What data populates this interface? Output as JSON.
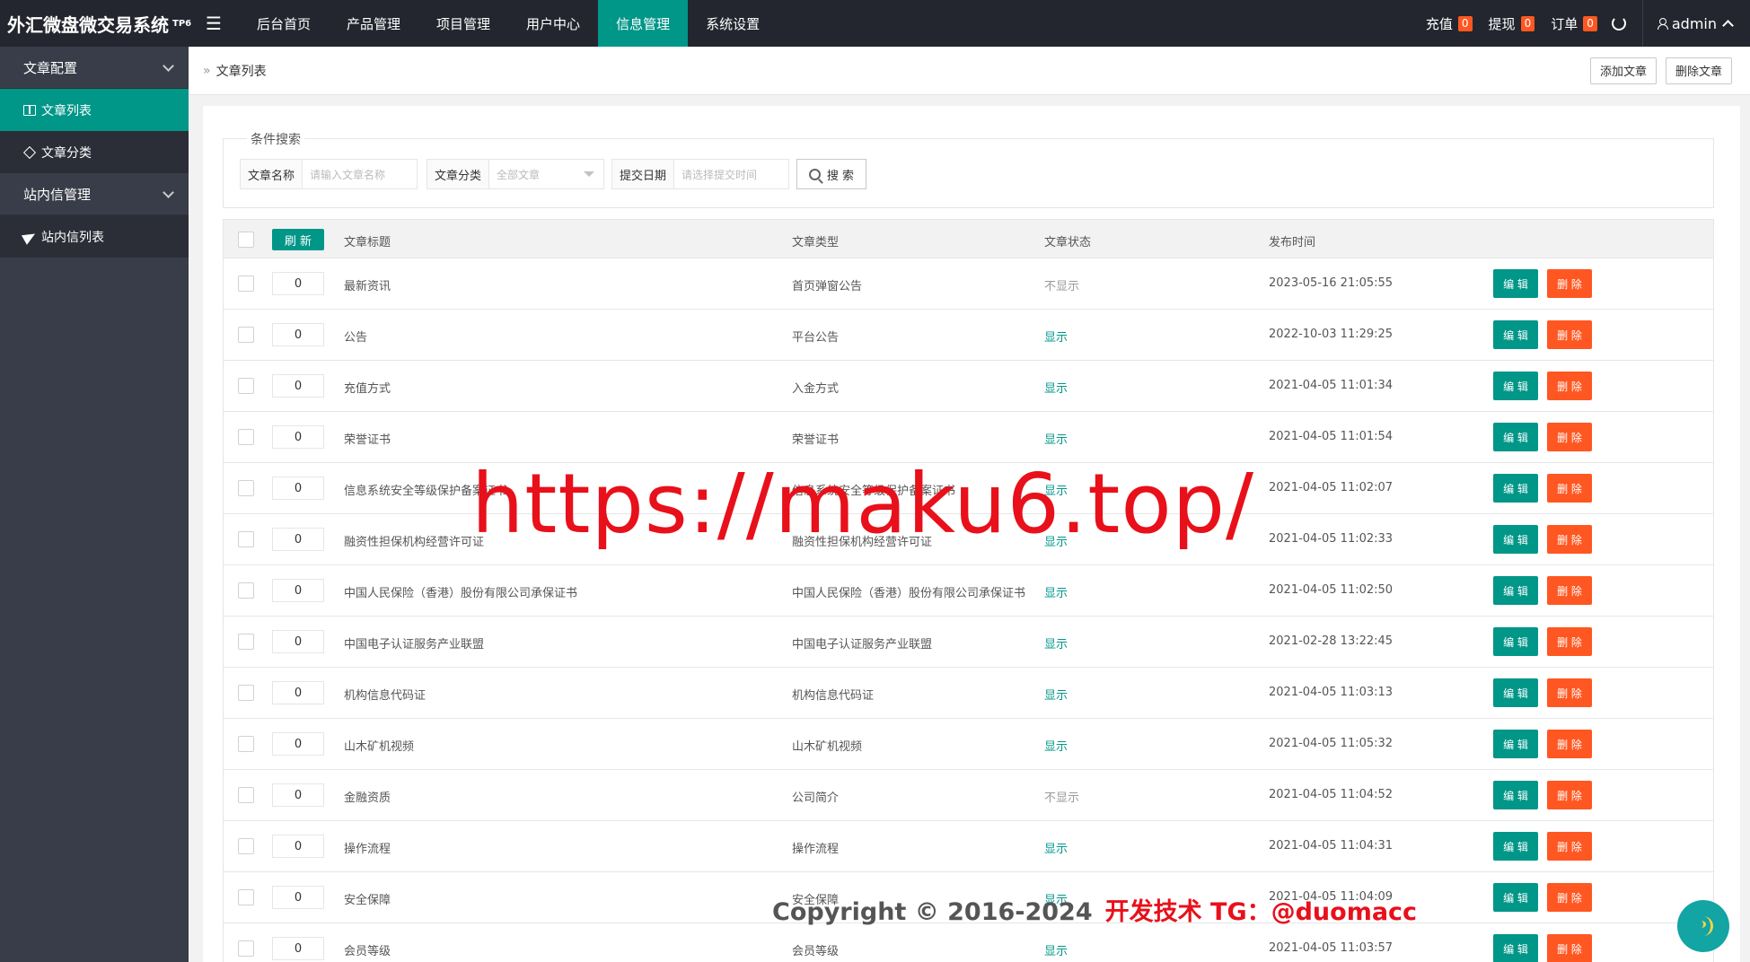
{
  "brand": {
    "title": "外汇微盘微交易系统",
    "sup": "TP6"
  },
  "nav": {
    "items": [
      "后台首页",
      "产品管理",
      "项目管理",
      "用户中心",
      "信息管理",
      "系统设置"
    ],
    "active_index": 4
  },
  "top_right": {
    "recharge": {
      "label": "充值",
      "count": "0"
    },
    "withdraw": {
      "label": "提现",
      "count": "0"
    },
    "order": {
      "label": "订单",
      "count": "0"
    },
    "user": "admin"
  },
  "sidebar": {
    "groups": [
      {
        "label": "文章配置",
        "items": [
          {
            "label": "文章列表",
            "icon": "book-icon",
            "active": true
          },
          {
            "label": "文章分类",
            "icon": "tag-icon",
            "active": false
          }
        ]
      },
      {
        "label": "站内信管理",
        "items": [
          {
            "label": "站内信列表",
            "icon": "send-icon",
            "active": false
          }
        ]
      }
    ]
  },
  "breadcrumb": {
    "sep": "»",
    "current": "文章列表"
  },
  "actions": {
    "add": "添加文章",
    "delete": "删除文章"
  },
  "search": {
    "legend": "条件搜索",
    "name_label": "文章名称",
    "name_placeholder": "请输入文章名称",
    "category_label": "文章分类",
    "category_value": "全部文章",
    "date_label": "提交日期",
    "date_placeholder": "请选择提交时间",
    "button": "搜 索"
  },
  "table": {
    "refresh": "刷 新",
    "headers": {
      "title": "文章标题",
      "type": "文章类型",
      "status": "文章状态",
      "time": "发布时间"
    },
    "edit_label": "编 辑",
    "delete_label": "删 除",
    "rows": [
      {
        "sort": "0",
        "title": "最新资讯",
        "type": "首页弹窗公告",
        "status": "不显示",
        "shown": false,
        "time": "2023-05-16 21:05:55"
      },
      {
        "sort": "0",
        "title": "公告",
        "type": "平台公告",
        "status": "显示",
        "shown": true,
        "time": "2022-10-03 11:29:25"
      },
      {
        "sort": "0",
        "title": "充值方式",
        "type": "入金方式",
        "status": "显示",
        "shown": true,
        "time": "2021-04-05 11:01:34"
      },
      {
        "sort": "0",
        "title": "荣誉证书",
        "type": "荣誉证书",
        "status": "显示",
        "shown": true,
        "time": "2021-04-05 11:01:54"
      },
      {
        "sort": "0",
        "title": "信息系统安全等级保护备案证书",
        "type": "信息系统安全等级保护备案证书",
        "status": "显示",
        "shown": true,
        "time": "2021-04-05 11:02:07"
      },
      {
        "sort": "0",
        "title": "融资性担保机构经营许可证",
        "type": "融资性担保机构经营许可证",
        "status": "显示",
        "shown": true,
        "time": "2021-04-05 11:02:33"
      },
      {
        "sort": "0",
        "title": "中国人民保险（香港）股份有限公司承保证书",
        "type": "中国人民保险（香港）股份有限公司承保证书",
        "status": "显示",
        "shown": true,
        "time": "2021-04-05 11:02:50"
      },
      {
        "sort": "0",
        "title": "中国电子认证服务产业联盟",
        "type": "中国电子认证服务产业联盟",
        "status": "显示",
        "shown": true,
        "time": "2021-02-28 13:22:45"
      },
      {
        "sort": "0",
        "title": "机构信息代码证",
        "type": "机构信息代码证",
        "status": "显示",
        "shown": true,
        "time": "2021-04-05 11:03:13"
      },
      {
        "sort": "0",
        "title": "山木矿机视频",
        "type": "山木矿机视频",
        "status": "显示",
        "shown": true,
        "time": "2021-04-05 11:05:32"
      },
      {
        "sort": "0",
        "title": "金融资质",
        "type": "公司简介",
        "status": "不显示",
        "shown": false,
        "time": "2021-04-05 11:04:52"
      },
      {
        "sort": "0",
        "title": "操作流程",
        "type": "操作流程",
        "status": "显示",
        "shown": true,
        "time": "2021-04-05 11:04:31"
      },
      {
        "sort": "0",
        "title": "安全保障",
        "type": "安全保障",
        "status": "显示",
        "shown": true,
        "time": "2021-04-05 11:04:09"
      },
      {
        "sort": "0",
        "title": "会员等级",
        "type": "会员等级",
        "status": "显示",
        "shown": true,
        "time": "2021-04-05 11:03:57"
      }
    ]
  },
  "overlay": {
    "watermark": "https://maku6.top/",
    "copyright": "Copyright © 2016-2024",
    "contact": "开发技术 TG：@duomacc"
  },
  "colors": {
    "accent": "#009688",
    "danger": "#ff5722",
    "topbar": "#23262e",
    "sidebar": "#393d49",
    "watermark": "#e8101a"
  }
}
